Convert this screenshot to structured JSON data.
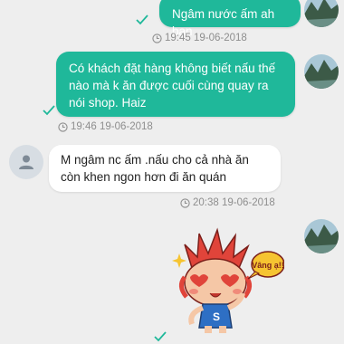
{
  "messages": [
    {
      "direction": "out",
      "text": "Ngâm nước ấm ah bạn",
      "time": "19:45 19-06-2018"
    },
    {
      "direction": "out",
      "text": "Có khách đặt hàng không biết nấu thế nào mà k ăn được cuối cùng quay ra nói shop. Haiz",
      "time": "19:46 19-06-2018"
    },
    {
      "direction": "in",
      "text": "M ngâm nc ấm .nấu cho cả nhà ăn còn khen ngon hơn đi ăn quán",
      "time": "20:38 19-06-2018"
    },
    {
      "direction": "out",
      "type": "sticker",
      "sticker_text": "Vâng ạ!!"
    }
  ],
  "colors": {
    "outgoing_bubble": "#1fb89a",
    "incoming_bubble": "#ffffff",
    "background": "#eeeeee",
    "check": "#1fb89a"
  },
  "icons": {
    "delivered": "check-icon",
    "timestamp": "clock-icon",
    "default_avatar": "person-icon"
  }
}
